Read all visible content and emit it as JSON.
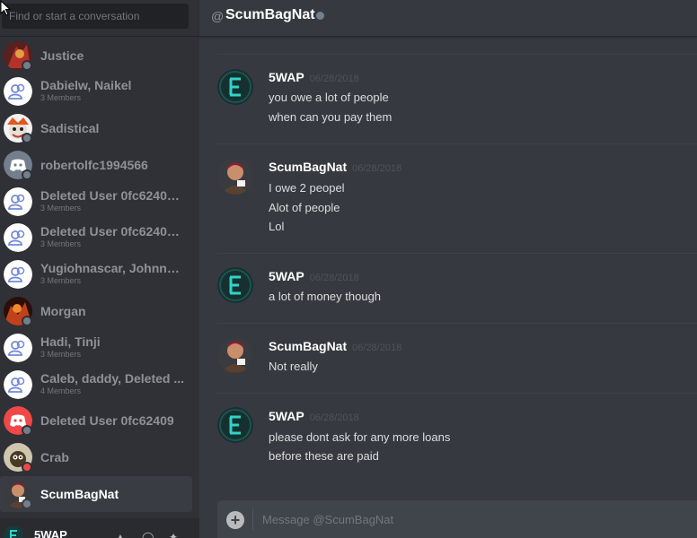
{
  "search": {
    "placeholder": "Find or start a conversation"
  },
  "dm_list": [
    {
      "name": "Justice",
      "subtitle": "",
      "status": "offline"
    },
    {
      "name": "Dabielw, Naikel",
      "subtitle": "3 Members"
    },
    {
      "name": "Sadistical",
      "subtitle": "",
      "status": "offline"
    },
    {
      "name": "robertolfc1994566",
      "subtitle": "",
      "status": "offline"
    },
    {
      "name": "Deleted User 0fc62409...",
      "subtitle": "3 Members"
    },
    {
      "name": "Deleted User 0fc62409...",
      "subtitle": "3 Members"
    },
    {
      "name": "Yugiohnascar, Johnny Boi",
      "subtitle": "3 Members"
    },
    {
      "name": "Morgan",
      "subtitle": "",
      "status": "offline"
    },
    {
      "name": "Hadi, Tinji",
      "subtitle": "3 Members"
    },
    {
      "name": "Caleb, daddy, Deleted ...",
      "subtitle": "4 Members"
    },
    {
      "name": "Deleted User 0fc62409",
      "subtitle": "",
      "status": "offline"
    },
    {
      "name": "Crab",
      "subtitle": "",
      "status": "dnd"
    },
    {
      "name": "ScumBagNat",
      "subtitle": "",
      "status": "offline",
      "active": true
    }
  ],
  "user_panel": {
    "name": "5WAP"
  },
  "header": {
    "at_symbol": "@",
    "title": "ScumBagNat"
  },
  "messages": [
    {
      "author": "5WAP",
      "timestamp": "06/28/2018",
      "lines": [
        "you owe a lot of people",
        "when can you pay them"
      ]
    },
    {
      "author": "ScumBagNat",
      "timestamp": "06/28/2018",
      "lines": [
        "I owe 2 peopel",
        "Alot of people",
        "Lol"
      ]
    },
    {
      "author": "5WAP",
      "timestamp": "06/28/2018",
      "lines": [
        "a lot of money though"
      ]
    },
    {
      "author": "ScumBagNat",
      "timestamp": "06/28/2018",
      "lines": [
        "Not really"
      ]
    },
    {
      "author": "5WAP",
      "timestamp": "06/28/2018",
      "lines": [
        "please dont ask for any more loans",
        "before these are paid"
      ]
    }
  ],
  "composer": {
    "placeholder": "Message @ScumBagNat",
    "add_icon": "plus-circle-icon"
  },
  "colors": {
    "background": "#36393f",
    "sidebar": "#2f3136",
    "composer": "#40444b",
    "status_offline": "#747f8d",
    "status_dnd": "#f04747"
  }
}
